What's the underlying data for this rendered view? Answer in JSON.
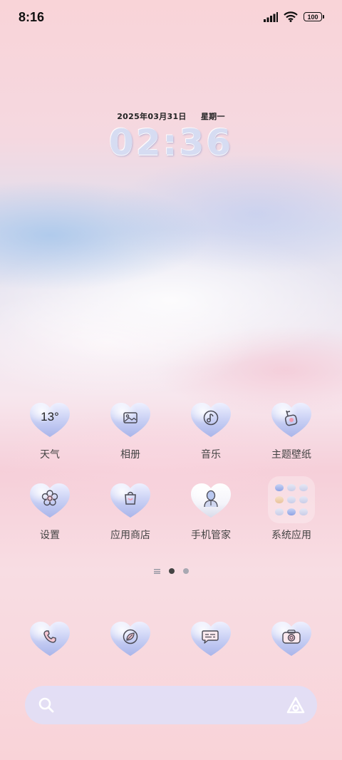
{
  "status_bar": {
    "time": "8:16",
    "battery": "100"
  },
  "clock": {
    "date": "2025年03月31日",
    "weekday": "星期一",
    "time": "02:36"
  },
  "apps": {
    "weather": {
      "label": "天气",
      "temp": "13°"
    },
    "gallery": {
      "label": "相册"
    },
    "music": {
      "label": "音乐"
    },
    "themes": {
      "label": "主题壁纸"
    },
    "settings": {
      "label": "设置"
    },
    "app_store": {
      "label": "应用商店"
    },
    "security": {
      "label": "手机管家"
    },
    "system_folder": {
      "label": "系统应用"
    }
  },
  "dock": {
    "items": [
      "phone-icon",
      "browser-icon",
      "messages-icon",
      "camera-icon"
    ]
  },
  "page_indicator": {
    "pages": 2,
    "current": 1
  },
  "colors": {
    "heart_top": "#dfe3fb",
    "heart_bottom": "#aab6ea",
    "glyph": "#4a4a55",
    "glyph_pink": "#f29ab0",
    "search_bg": "#e1def5"
  }
}
